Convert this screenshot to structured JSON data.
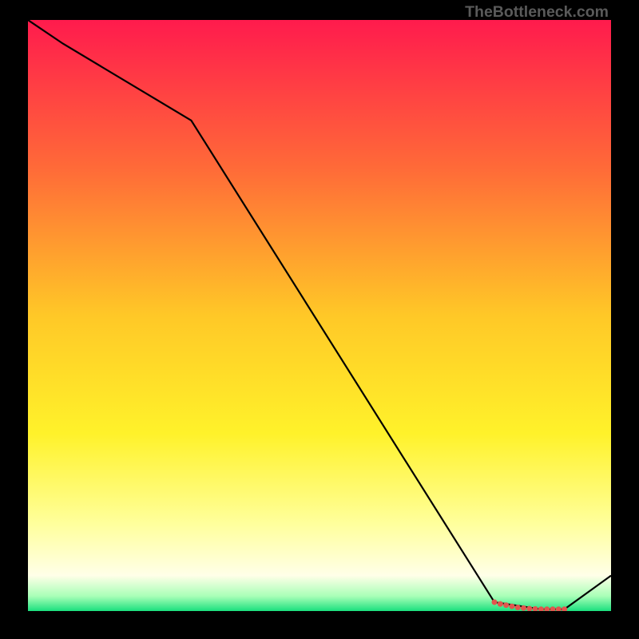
{
  "watermark": "TheBottleneck.com",
  "chart_data": {
    "type": "line",
    "title": "",
    "xlabel": "",
    "ylabel": "",
    "xlim": [
      0,
      100
    ],
    "ylim": [
      0,
      100
    ],
    "x": [
      0,
      6,
      28,
      80,
      88,
      92,
      100
    ],
    "values": [
      100,
      96,
      83,
      1.5,
      0.3,
      0.3,
      6
    ],
    "markers": {
      "x": [
        80,
        81,
        82,
        83,
        84,
        85,
        86,
        87,
        88,
        89,
        90,
        91,
        92
      ],
      "y": [
        1.5,
        1.2,
        1.0,
        0.8,
        0.6,
        0.5,
        0.4,
        0.35,
        0.3,
        0.3,
        0.3,
        0.3,
        0.3
      ]
    },
    "background_gradient": {
      "type": "vertical",
      "stops": [
        {
          "pos": 0.0,
          "color": "#ff1b4d"
        },
        {
          "pos": 0.25,
          "color": "#ff6a38"
        },
        {
          "pos": 0.5,
          "color": "#ffc827"
        },
        {
          "pos": 0.7,
          "color": "#fff22a"
        },
        {
          "pos": 0.85,
          "color": "#ffff9a"
        },
        {
          "pos": 0.94,
          "color": "#ffffe8"
        },
        {
          "pos": 0.975,
          "color": "#a8ffb7"
        },
        {
          "pos": 1.0,
          "color": "#1ae07e"
        }
      ]
    }
  }
}
